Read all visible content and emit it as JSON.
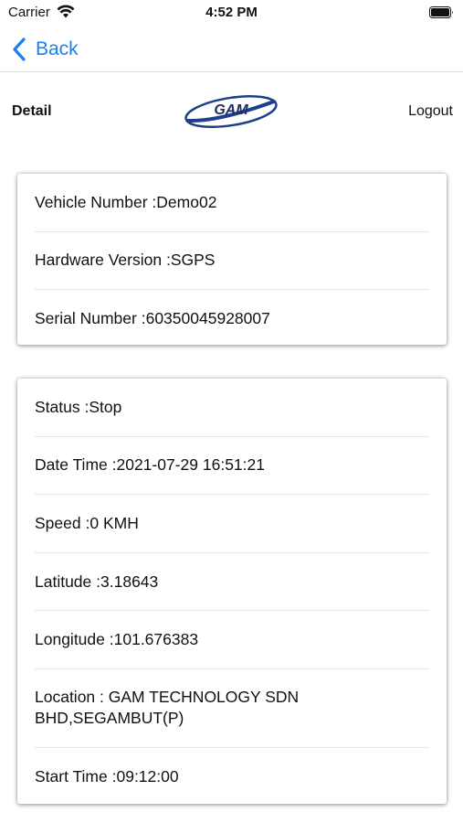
{
  "status_bar": {
    "carrier": "Carrier",
    "time": "4:52 PM",
    "wifi_icon": "wifi-icon",
    "battery_icon": "battery-icon"
  },
  "nav": {
    "back_label": "Back",
    "back_icon": "chevron-left-icon",
    "accent_color": "#1a7ff0"
  },
  "header": {
    "title": "Detail",
    "logo_text": "GAM",
    "logout_label": "Logout"
  },
  "vehicle_card": {
    "vehicle_number": {
      "label": "Vehicle Number",
      "value": "Demo02"
    },
    "hardware_version": {
      "label": "Hardware Version",
      "value": "SGPS"
    },
    "serial_number": {
      "label": "Serial Number",
      "value": "60350045928007"
    }
  },
  "status_card": {
    "status": {
      "label": "Status",
      "value": "Stop"
    },
    "date_time": {
      "label": "Date Time",
      "value": "2021-07-29 16:51:21"
    },
    "speed": {
      "label": "Speed",
      "value": "0 KMH"
    },
    "latitude": {
      "label": "Latitude",
      "value": "3.18643"
    },
    "longitude": {
      "label": "Longitude",
      "value": "101.676383"
    },
    "location": {
      "label": "Location",
      "value": "GAM TECHNOLOGY SDN BHD,SEGAMBUT(P)"
    },
    "start_time": {
      "label": "Start Time",
      "value": "09:12:00"
    }
  }
}
